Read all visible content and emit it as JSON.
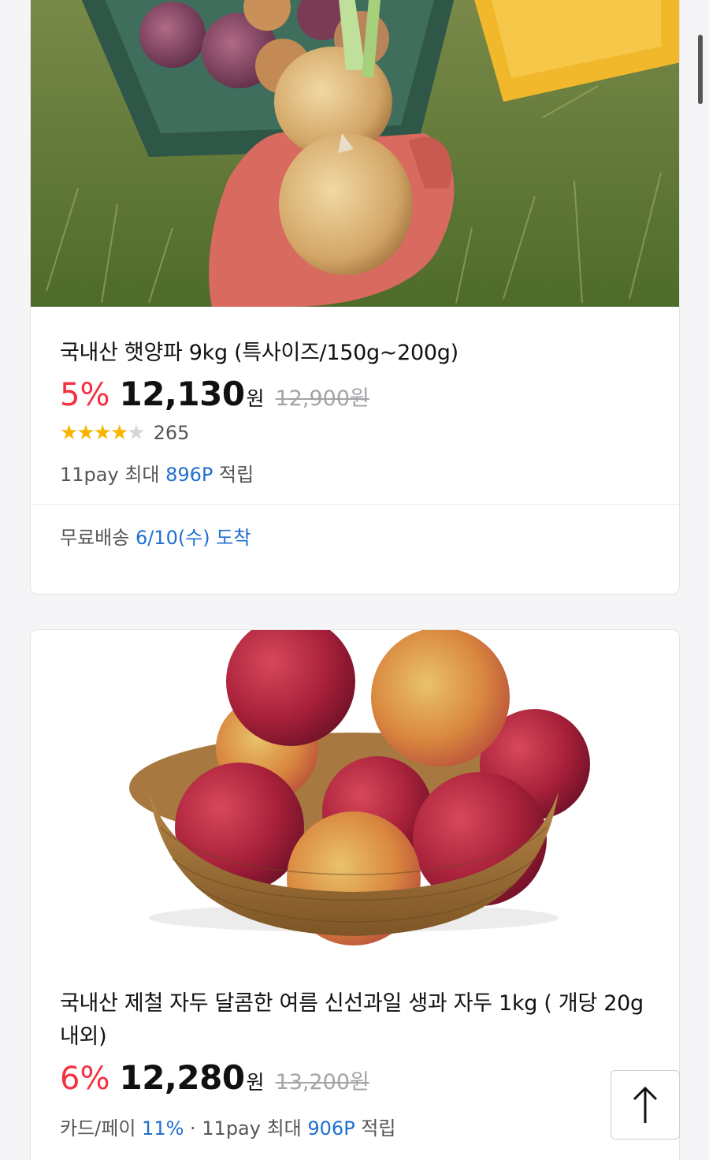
{
  "products": [
    {
      "image": "onion-photo",
      "title": "국내산 햇양파 9kg (특사이즈/150g~200g)",
      "discount": "5%",
      "price": "12,130",
      "currency": "원",
      "original_price": "12,900원",
      "rating_stars": 4,
      "rating_count": "265",
      "points_prefix": "11pay 최대 ",
      "points_value": "896P",
      "points_suffix": " 적립",
      "shipping_prefix": "무료배송 ",
      "shipping_date": "6/10(수) 도착"
    },
    {
      "image": "plum-photo",
      "title": "국내산 제철 자두 달콤한 여름 신선과일 생과 자두 1kg ( 개당 20g내외)",
      "discount": "6%",
      "price": "12,280",
      "currency": "원",
      "original_price": "13,200원",
      "card_label": "카드/페이 ",
      "card_value": "11%",
      "points_prefix": " · 11pay 최대 ",
      "points_value": "906P",
      "points_suffix": " 적립"
    }
  ],
  "icons": {
    "scroll_top": "arrow-up-icon",
    "star": "star-icon"
  },
  "colors": {
    "discount": "#f43142",
    "accent_blue": "#1f6fd1",
    "star": "#f7b500"
  }
}
